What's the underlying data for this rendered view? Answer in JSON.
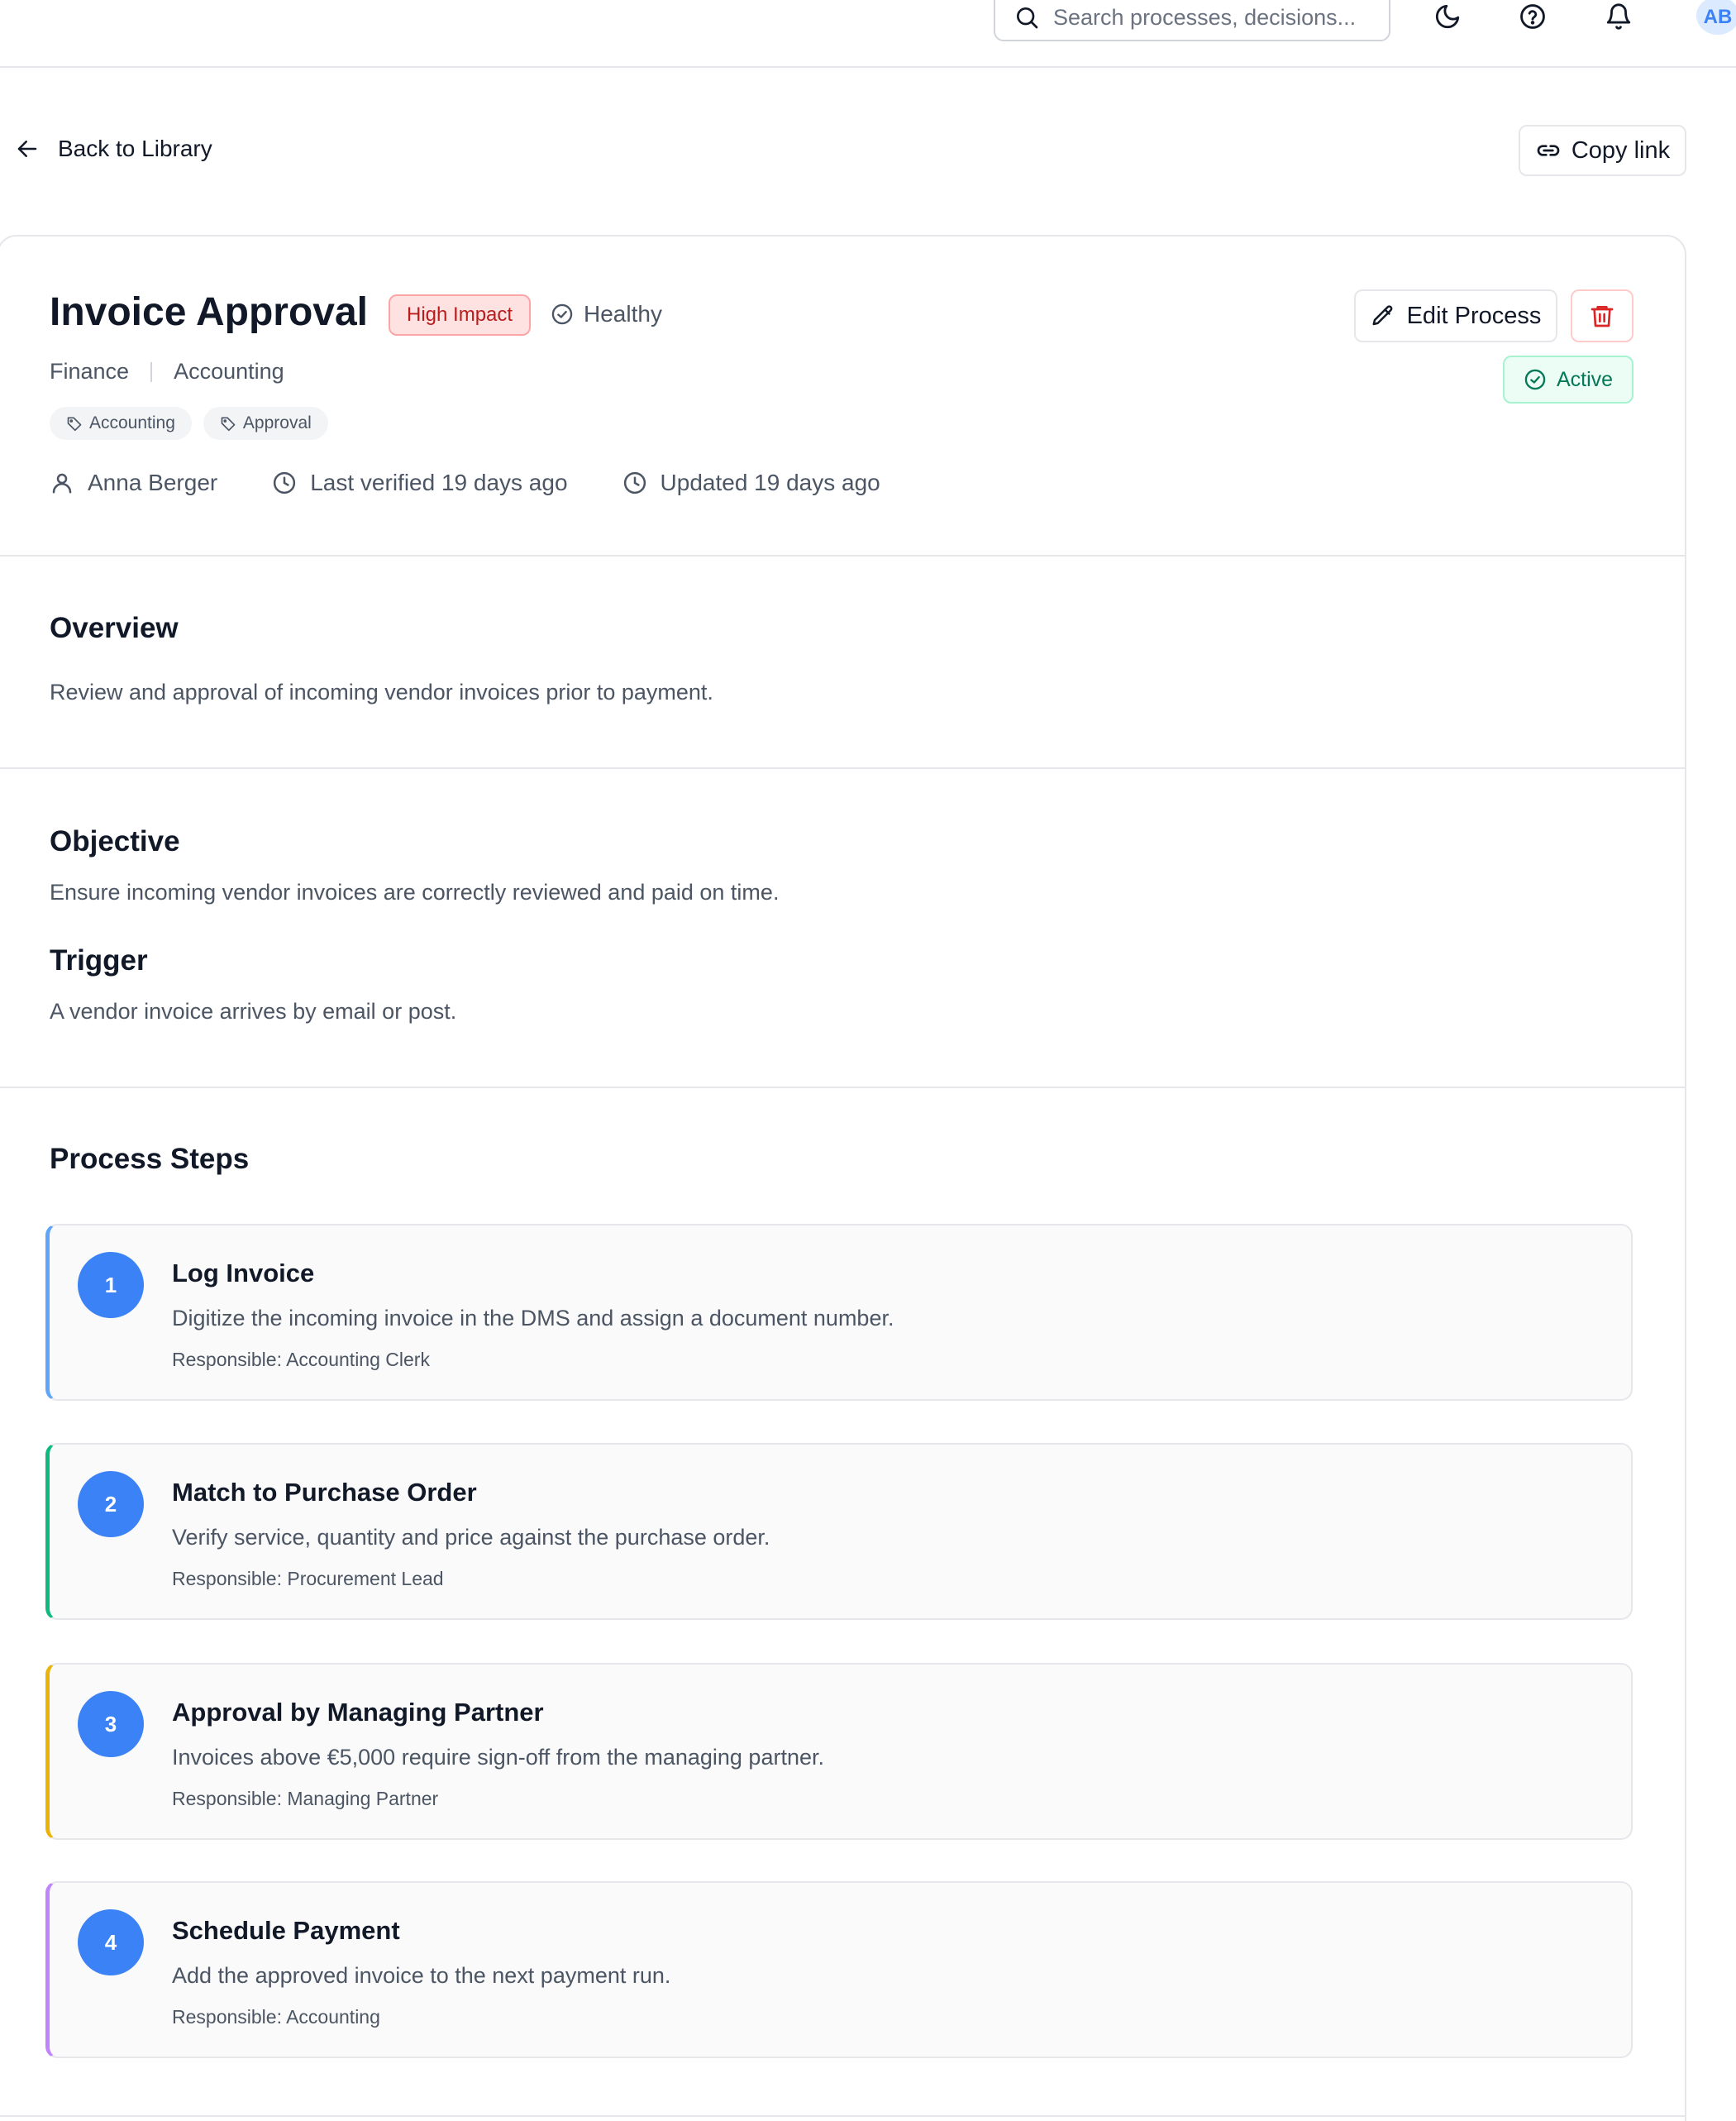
{
  "header": {
    "search_placeholder": "Search processes, decisions...",
    "avatar_initials": "AB"
  },
  "nav": {
    "back_label": "Back to Library",
    "copy_link_label": "Copy link"
  },
  "process": {
    "title": "Invoice Approval",
    "impact_badge": "High Impact",
    "health": "Healthy",
    "status": "Active",
    "edit_label": "Edit Process",
    "breadcrumb": [
      "Finance",
      "Accounting"
    ],
    "tags": [
      "Accounting",
      "Approval"
    ],
    "owner": "Anna Berger",
    "last_verified": "Last verified 19 days ago",
    "updated": "Updated 19 days ago"
  },
  "overview": {
    "heading": "Overview",
    "text": "Review and approval of incoming vendor invoices prior to payment."
  },
  "objective": {
    "heading": "Objective",
    "text": "Ensure incoming vendor invoices are correctly reviewed and paid on time."
  },
  "trigger": {
    "heading": "Trigger",
    "text": "A vendor invoice arrives by email or post."
  },
  "steps": {
    "heading": "Process Steps",
    "items": [
      {
        "number": "1",
        "title": "Log Invoice",
        "description": "Digitize the incoming invoice in the DMS and assign a document number.",
        "responsible": "Responsible: Accounting Clerk",
        "accent": "#60a5fa"
      },
      {
        "number": "2",
        "title": "Match to Purchase Order",
        "description": "Verify service, quantity and price against the purchase order.",
        "responsible": "Responsible: Procurement Lead",
        "accent": "#10b981"
      },
      {
        "number": "3",
        "title": "Approval by Managing Partner",
        "description": "Invoices above €5,000 require sign-off from the managing partner.",
        "responsible": "Responsible: Managing Partner",
        "accent": "#eab308"
      },
      {
        "number": "4",
        "title": "Schedule Payment",
        "description": "Add the approved invoice to the next payment run.",
        "responsible": "Responsible: Accounting",
        "accent": "#c084fc"
      }
    ]
  },
  "colors": {
    "primary": "#3b82f6",
    "danger": "#dc2626",
    "success": "#047857"
  }
}
